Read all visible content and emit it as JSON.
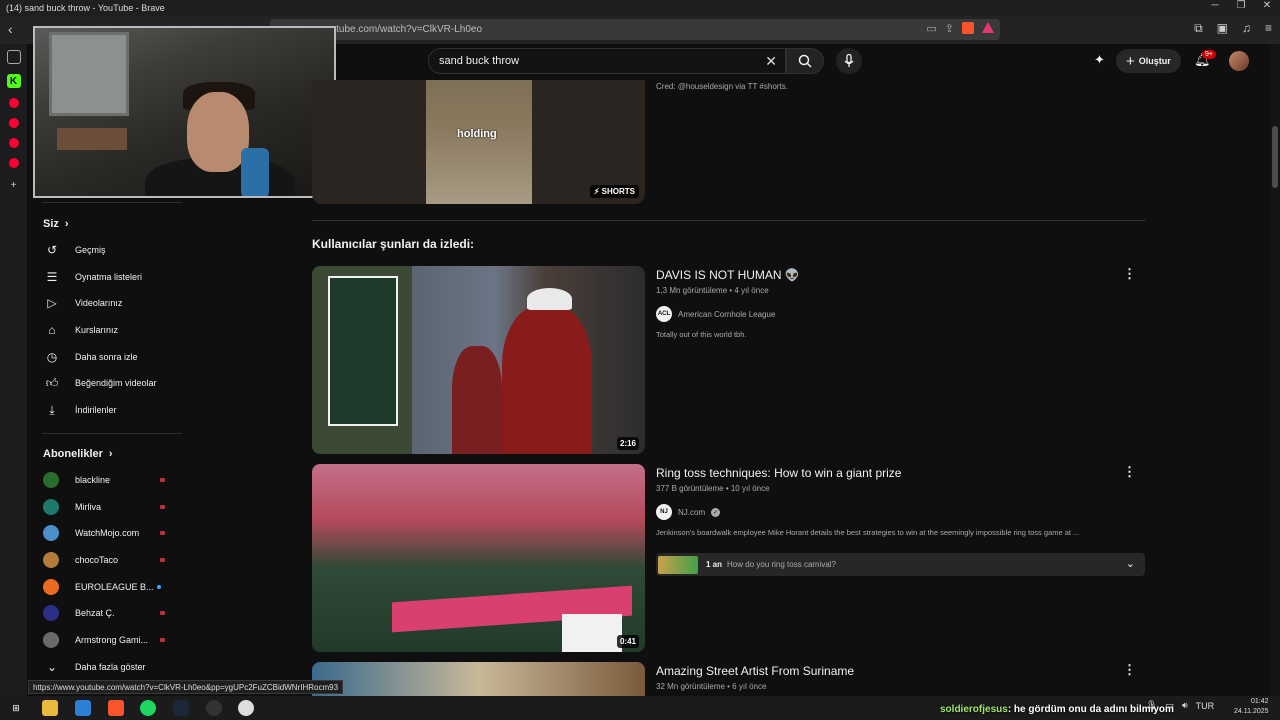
{
  "window": {
    "title": "(14) sand buck throw - YouTube - Brave"
  },
  "browser": {
    "url": "youtube.com/watch?v=ClkVR-Lh0eo"
  },
  "header": {
    "search_value": "sand buck throw",
    "create_label": "Oluştur",
    "notif_count": "9+"
  },
  "shorts": {
    "overlay_text": "holding",
    "badge": "SHORTS",
    "cred": "Cred: @houseldesign via TT #shorts."
  },
  "section_title": "Kullanıcılar şunları da izledi:",
  "sidebar": {
    "you_label": "Siz",
    "you_items": [
      {
        "label": "Geçmiş",
        "icon": "history-icon"
      },
      {
        "label": "Oynatma listeleri",
        "icon": "playlist-icon"
      },
      {
        "label": "Videolarınız",
        "icon": "video-icon"
      },
      {
        "label": "Kurslarınız",
        "icon": "course-icon"
      },
      {
        "label": "Daha sonra izle",
        "icon": "clock-icon"
      },
      {
        "label": "Beğendiğim videolar",
        "icon": "like-icon"
      },
      {
        "label": "İndirilenler",
        "icon": "download-icon"
      }
    ],
    "subs_label": "Abonelikler",
    "subs": [
      {
        "label": "blackline",
        "color": "#2a6e2f"
      },
      {
        "label": "Mirliva",
        "color": "#1b7a6b"
      },
      {
        "label": "WatchMojo.com",
        "color": "#4d8fc9"
      },
      {
        "label": "chocoTaco",
        "color": "#b27b3c"
      },
      {
        "label": "EUROLEAGUE B...",
        "color": "#e86b20"
      },
      {
        "label": "Behzat Ç.",
        "color": "#2d2d8a"
      },
      {
        "label": "Armstrong Gami...",
        "color": "#6a6a6a"
      }
    ],
    "show_more": "Daha fazla göster"
  },
  "videos": [
    {
      "title": "DAVIS IS NOT HUMAN 👽",
      "meta": "1,3 Mn görüntüleme • 4 yıl önce",
      "channel": "American Cornhole League",
      "channel_abbr": "ACL",
      "desc": "Totally out of this world tbh.",
      "duration": "2:16"
    },
    {
      "title": "Ring toss techniques: How to win a giant prize",
      "meta": "377 B görüntüleme • 10 yıl önce",
      "channel": "NJ.com",
      "channel_abbr": "NJ",
      "desc": "Jenkinson's boardwalk employee Mike Horant details the best strategies to win at the seemingly impossible ring toss game at ...",
      "duration": "0:41",
      "chapter_time": "1 an",
      "chapter_label": "How do you ring toss carnival?"
    },
    {
      "title": "Amazing Street Artist From Suriname",
      "meta": "32 Mn görüntüleme • 6 yıl önce"
    }
  ],
  "status_url": "https://www.youtube.com/watch?v=ClkVR-Lh0eo&pp=ygUPc2FuZCBidWNrIHRocm93",
  "chat": {
    "user": "soldierofjesus",
    "message": ": he gördüm onu da adını bilmiyom"
  },
  "tray": {
    "lang": "TUR",
    "time": "01:42",
    "date": "24.11.2025"
  }
}
